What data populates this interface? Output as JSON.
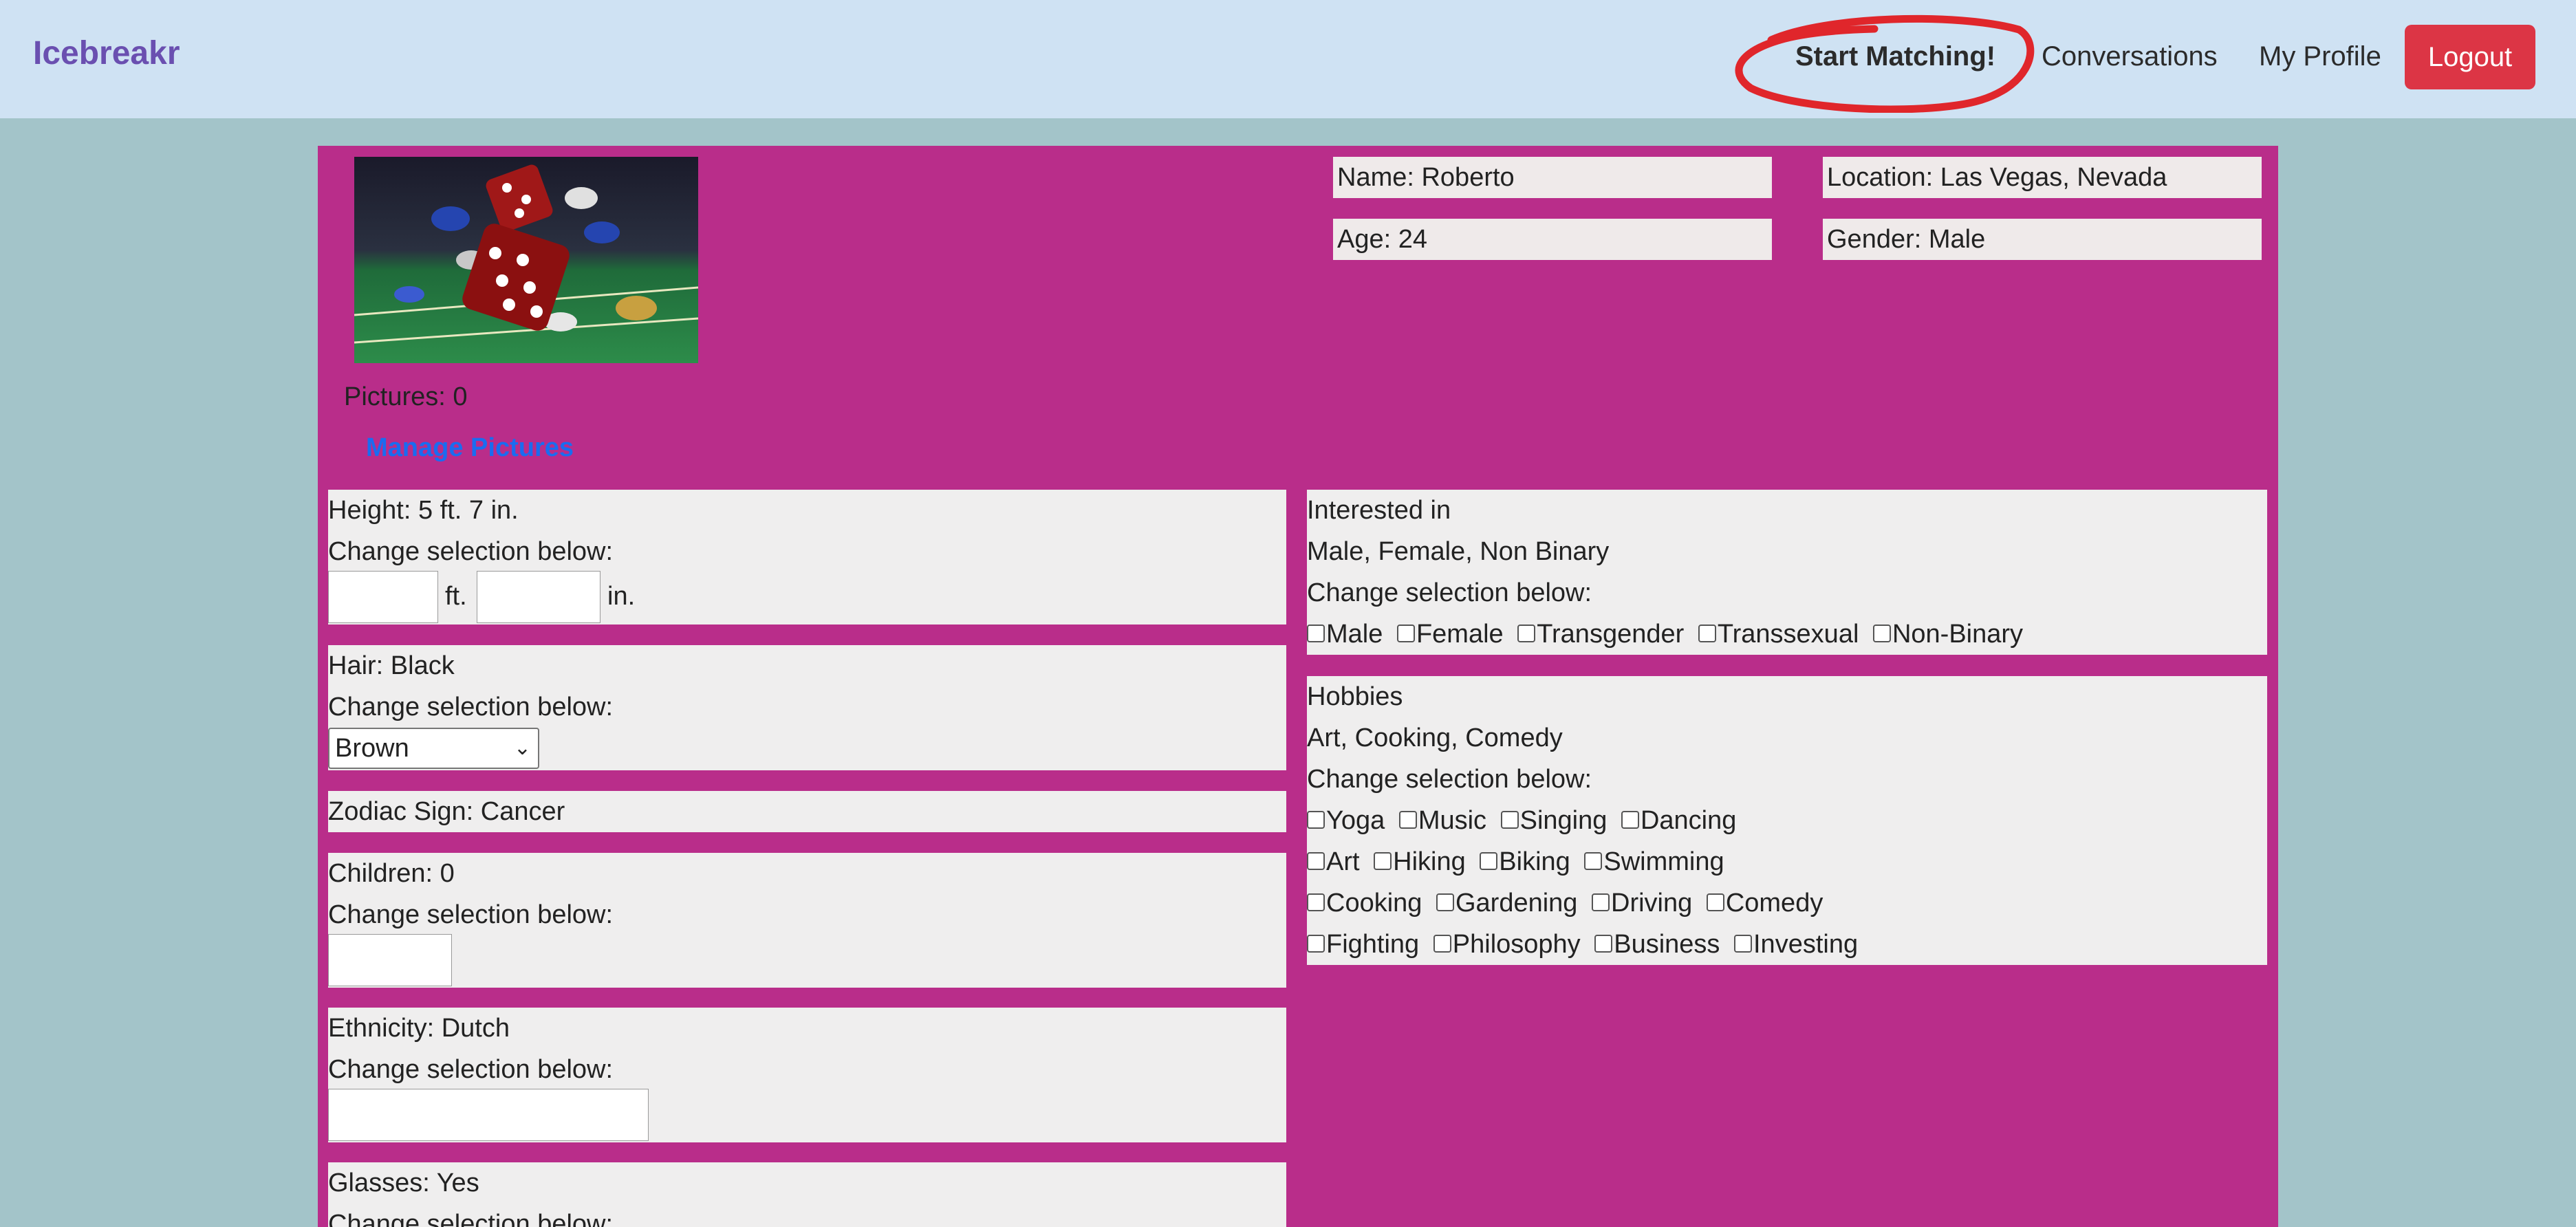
{
  "navbar": {
    "brand": "Icebreakr",
    "links": {
      "start_matching": "Start Matching!",
      "conversations": "Conversations",
      "my_profile": "My Profile"
    },
    "logout": "Logout"
  },
  "profile": {
    "pictures_count": "Pictures: 0",
    "manage_pictures": "Manage Pictures",
    "name": "Name: Roberto",
    "location": "Location: Las Vegas, Nevada",
    "age": "Age: 24",
    "gender": "Gender: Male"
  },
  "height": {
    "label": "Height: 5 ft. 7 in.",
    "change": "Change selection below:",
    "ft_unit": "ft.",
    "in_unit": "in."
  },
  "hair": {
    "label": "Hair: Black",
    "change": "Change selection below:",
    "selected": "Brown"
  },
  "zodiac": {
    "label": "Zodiac Sign: Cancer"
  },
  "children": {
    "label": "Children: 0",
    "change": "Change selection below:"
  },
  "ethnicity": {
    "label": "Ethnicity: Dutch",
    "change": "Change selection below:"
  },
  "glasses": {
    "label": "Glasses: Yes",
    "change": "Change selection below:"
  },
  "interested": {
    "title": "Interested in",
    "current": "Male, Female, Non Binary",
    "change": "Change selection below:",
    "options": [
      "Male",
      "Female",
      "Transgender",
      "Transsexual",
      "Non-Binary"
    ]
  },
  "hobbies": {
    "title": "Hobbies",
    "current": "Art, Cooking, Comedy",
    "change": "Change selection below:",
    "rows": [
      [
        "Yoga",
        "Music",
        "Singing",
        "Dancing"
      ],
      [
        "Art",
        "Hiking",
        "Biking",
        "Swimming"
      ],
      [
        "Cooking",
        "Gardening",
        "Driving",
        "Comedy"
      ],
      [
        "Fighting",
        "Philosophy",
        "Business",
        "Investing"
      ]
    ]
  },
  "colors": {
    "navbar_bg": "#cfe2f3",
    "page_bg": "#a3c4c9",
    "panel_bg": "#b92d8a",
    "brand": "#6a4fb0",
    "logout_bg": "#dc3545",
    "annotation_circle": "#e0262b",
    "link": "#1a6cf0"
  }
}
